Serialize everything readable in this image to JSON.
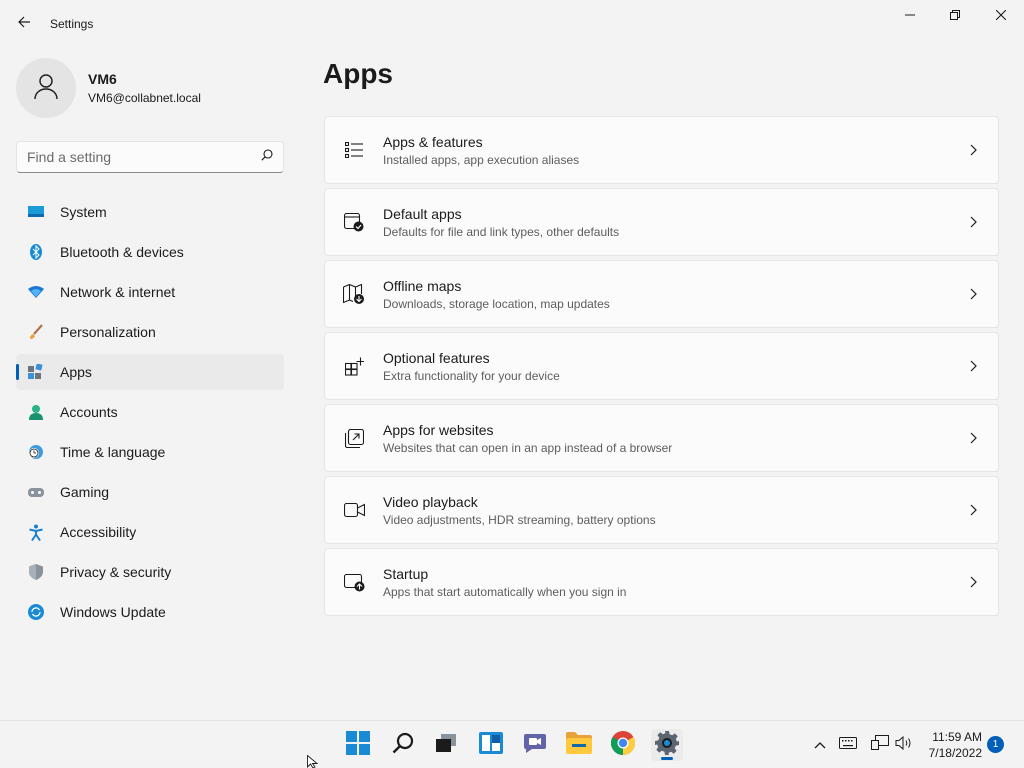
{
  "window": {
    "title": "Settings",
    "back_icon": "back-arrow-icon",
    "minimize_icon": "minimize-icon",
    "maximize_icon": "restore-icon",
    "close_icon": "close-icon"
  },
  "profile": {
    "name": "VM6",
    "email": "VM6@collabnet.local",
    "avatar_icon": "person-icon"
  },
  "search": {
    "placeholder": "Find a setting",
    "value": "",
    "icon": "search-icon"
  },
  "nav": {
    "active": "Apps",
    "items": [
      {
        "label": "System",
        "icon": "monitor-icon"
      },
      {
        "label": "Bluetooth & devices",
        "icon": "bluetooth-icon"
      },
      {
        "label": "Network & internet",
        "icon": "wifi-icon"
      },
      {
        "label": "Personalization",
        "icon": "brush-icon"
      },
      {
        "label": "Apps",
        "icon": "apps-icon"
      },
      {
        "label": "Accounts",
        "icon": "account-icon"
      },
      {
        "label": "Time & language",
        "icon": "globe-clock-icon"
      },
      {
        "label": "Gaming",
        "icon": "gamepad-icon"
      },
      {
        "label": "Accessibility",
        "icon": "accessibility-icon"
      },
      {
        "label": "Privacy & security",
        "icon": "shield-icon"
      },
      {
        "label": "Windows Update",
        "icon": "update-icon"
      }
    ]
  },
  "main": {
    "title": "Apps",
    "cards": [
      {
        "title": "Apps & features",
        "subtitle": "Installed apps, app execution aliases",
        "icon": "list-icon"
      },
      {
        "title": "Default apps",
        "subtitle": "Defaults for file and link types, other defaults",
        "icon": "default-apps-icon"
      },
      {
        "title": "Offline maps",
        "subtitle": "Downloads, storage location, map updates",
        "icon": "map-download-icon"
      },
      {
        "title": "Optional features",
        "subtitle": "Extra functionality for your device",
        "icon": "add-grid-icon"
      },
      {
        "title": "Apps for websites",
        "subtitle": "Websites that can open in an app instead of a browser",
        "icon": "open-external-icon"
      },
      {
        "title": "Video playback",
        "subtitle": "Video adjustments, HDR streaming, battery options",
        "icon": "video-icon"
      },
      {
        "title": "Startup",
        "subtitle": "Apps that start automatically when you sign in",
        "icon": "startup-icon"
      }
    ]
  },
  "taskbar": {
    "apps": [
      "start-icon",
      "search-icon",
      "task-view-icon",
      "widgets-icon",
      "chat-icon",
      "file-explorer-icon",
      "chrome-icon",
      "settings-gear-icon"
    ],
    "tray_icons": [
      "chevron-up-icon",
      "keyboard-icon",
      "network-icon",
      "volume-icon"
    ],
    "time": "11:59 AM",
    "date": "7/18/2022",
    "notification_count": "1"
  },
  "colors": {
    "accent": "#005fb8",
    "background": "#f3f3f3",
    "card": "#fbfbfb"
  }
}
